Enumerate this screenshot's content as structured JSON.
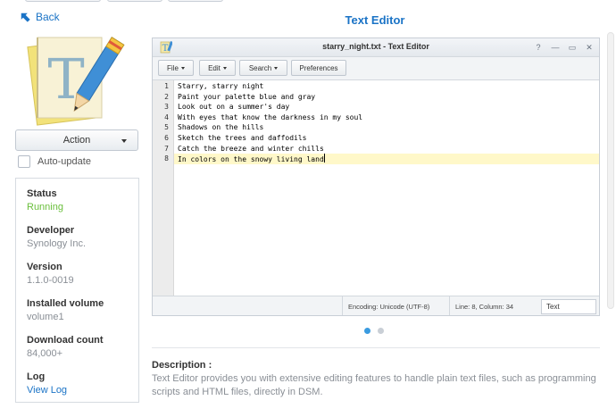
{
  "nav": {
    "back_label": "Back"
  },
  "app": {
    "title": "Text Editor",
    "action_label": "Action",
    "auto_update_label": "Auto-update",
    "logo_letter": "T"
  },
  "info": [
    {
      "label": "Status",
      "value": "Running"
    },
    {
      "label": "Developer",
      "value": "Synology Inc."
    },
    {
      "label": "Version",
      "value": "1.1.0-0019"
    },
    {
      "label": "Installed volume",
      "value": "volume1"
    },
    {
      "label": "Download count",
      "value": "84,000+"
    },
    {
      "label": "Log",
      "value": "View Log"
    }
  ],
  "screenshot": {
    "window_title": "starry_night.txt - Text Editor",
    "icon_letter": "T",
    "window_buttons": [
      "?",
      "—",
      "▭",
      "✕"
    ],
    "toolbar": {
      "file": "File",
      "edit": "Edit",
      "search": "Search",
      "preferences": "Preferences"
    },
    "lines": [
      {
        "num": "1",
        "text": "Starry, starry night"
      },
      {
        "num": "2",
        "text": "Paint your palette blue and gray"
      },
      {
        "num": "3",
        "text": "Look out on a summer's day"
      },
      {
        "num": "4",
        "text": "With eyes that know the darkness in my soul"
      },
      {
        "num": "5",
        "text": "Shadows on the hills"
      },
      {
        "num": "6",
        "text": "Sketch the trees and daffodils"
      },
      {
        "num": "7",
        "text": "Catch the breeze and winter chills"
      },
      {
        "num": "8",
        "text": "In colors on the snowy living land"
      }
    ],
    "status": {
      "encoding": "Encoding: Unicode (UTF-8)",
      "position": "Line: 8, Column: 34",
      "mode": "Text"
    }
  },
  "pager": {
    "count": 2,
    "active": 1
  },
  "description": {
    "title": "Description :",
    "text": "Text Editor provides you with extensive editing features to handle plain text files, such as programming scripts and HTML files, directly in DSM."
  },
  "colors": {
    "accent": "#1a73c6",
    "running": "#6abf3c",
    "active_line": "#fff8c9",
    "active_dot": "#3a9be0"
  }
}
